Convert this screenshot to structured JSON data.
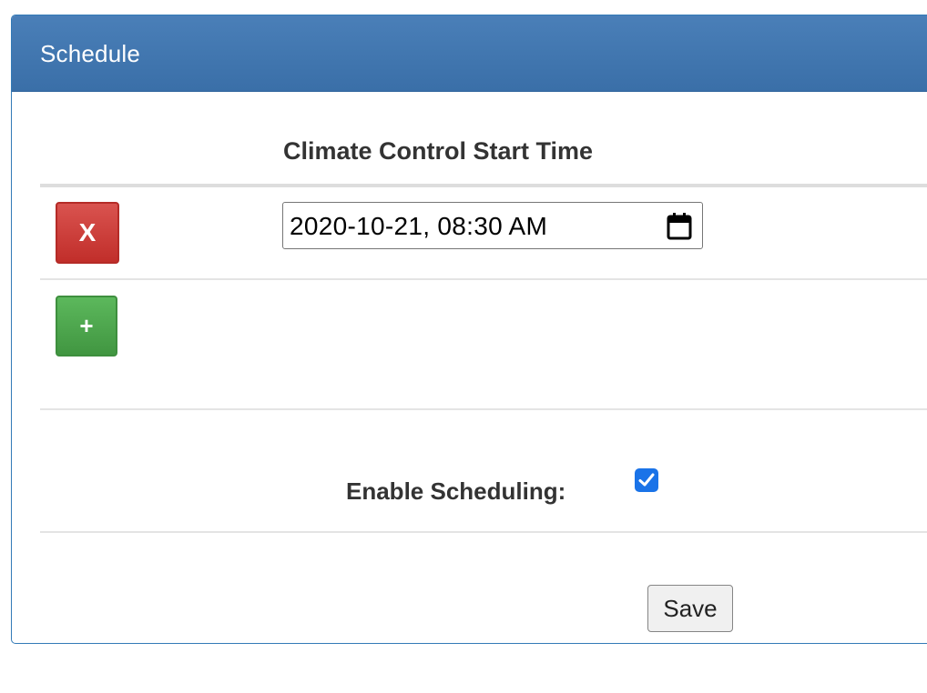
{
  "panel": {
    "title": "Schedule",
    "accent_color": "#337ab7"
  },
  "table": {
    "column_header": "Climate Control Start Time",
    "rows": [
      {
        "remove_label": "X",
        "datetime_value": "2020-10-21, 08:30 AM"
      }
    ],
    "add_label": "+"
  },
  "scheduling": {
    "label": "Enable Scheduling:",
    "enabled": true
  },
  "actions": {
    "save_label": "Save"
  },
  "colors": {
    "danger": "#d9534f",
    "success": "#5cb85c",
    "checkbox": "#1a73e8"
  },
  "icons": {
    "datetime_picker": "calendar-icon",
    "checkbox_mark": "checkmark-icon"
  }
}
